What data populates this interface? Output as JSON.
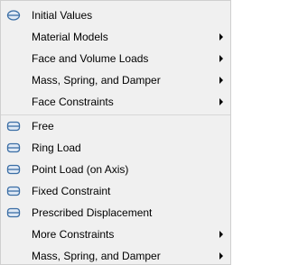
{
  "menu": {
    "items_top": [
      {
        "label": "Initial Values",
        "icon": "initial-values-icon",
        "submenu": false
      },
      {
        "label": "Material Models",
        "icon": "",
        "submenu": true
      },
      {
        "label": "Face and Volume Loads",
        "icon": "",
        "submenu": true
      },
      {
        "label": "Mass, Spring, and Damper",
        "icon": "",
        "submenu": true
      },
      {
        "label": "Face Constraints",
        "icon": "",
        "submenu": true
      }
    ],
    "items_bottom": [
      {
        "label": "Free",
        "icon": "boundary-free-icon",
        "submenu": false
      },
      {
        "label": "Ring Load",
        "icon": "boundary-ring-load-icon",
        "submenu": false
      },
      {
        "label": "Point Load (on Axis)",
        "icon": "boundary-point-load-icon",
        "submenu": false
      },
      {
        "label": "Fixed Constraint",
        "icon": "boundary-fixed-constraint-icon",
        "submenu": false
      },
      {
        "label": "Prescribed Displacement",
        "icon": "boundary-prescribed-displacement-icon",
        "submenu": false
      },
      {
        "label": "More Constraints",
        "icon": "",
        "submenu": true
      },
      {
        "label": "Mass, Spring, and Damper",
        "icon": "",
        "submenu": true
      }
    ]
  },
  "colors": {
    "menu_background": "#f0f0f0",
    "icon_blue": "#3b6ea5",
    "icon_fill": "#dfe9f5"
  }
}
